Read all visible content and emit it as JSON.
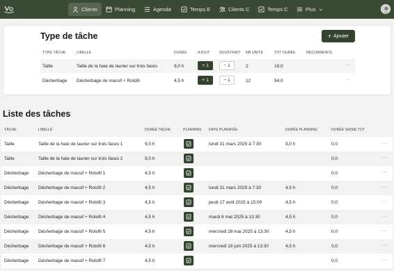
{
  "nav": {
    "items": [
      {
        "label": "Clients",
        "icon": "user-icon",
        "active": true
      },
      {
        "label": "Planning",
        "icon": "calendar-icon",
        "active": false
      },
      {
        "label": "Agenda",
        "icon": "list-icon",
        "active": false
      },
      {
        "label": "Temps E",
        "icon": "timesheet-icon",
        "active": false
      },
      {
        "label": "Clients C",
        "icon": "users-icon",
        "active": false
      },
      {
        "label": "Temps C",
        "icon": "timesheet-icon",
        "active": false
      },
      {
        "label": "Plus",
        "icon": "menu-icon",
        "active": false
      }
    ]
  },
  "task_types": {
    "title": "Type de tâche",
    "add_label": "Ajouter",
    "headers": {
      "type": "TYPE TÂCHE",
      "libelle": "LIBELLÉ",
      "duree": "DURÉE",
      "ajout": "AJOUT",
      "soustrait": "SOUSTRAIT",
      "nb_unite": "NB UNITÉ",
      "tot_duree": "TOT DURÉE",
      "recurrence": "RÉCURRENCE"
    },
    "rows": [
      {
        "type": "Taille",
        "libelle": "Taille de la haie de laurier sur trois faces",
        "duree": "9,0 h",
        "ajout": "1",
        "soustrait": "1",
        "nb_unite": "2",
        "tot_duree": "18,0",
        "menu": "···"
      },
      {
        "type": "Désherbage",
        "libelle": "Désherbage de massif + Rotofil",
        "duree": "4,5 h",
        "ajout": "1",
        "soustrait": "1",
        "nb_unite": "12",
        "tot_duree": "54,0",
        "menu": "···"
      }
    ]
  },
  "task_list": {
    "title": "Liste des tâches",
    "headers": {
      "tache": "TÂCHE",
      "libelle": "LIBELLÉ",
      "duree_tache": "DURÉE TÂCHE",
      "planning": "PLANNING",
      "date_planifiee": "DATE PLANIFIÉE",
      "duree_planning": "DURÉE PLANNING",
      "duree_saisie": "DURÉE SAISIE TOT"
    },
    "rows": [
      {
        "tache": "Taille",
        "libelle": "Taille de la haie de laurier sur trois faces 1",
        "duree_tache": "9,0 h",
        "date_planifiee": "lundi 31 mars 2025 à 7:30",
        "duree_planning": "9,0 h",
        "duree_saisie": "0,0",
        "menu": "···"
      },
      {
        "tache": "Taille",
        "libelle": "Taille de la haie de laurier sur trois faces 2",
        "duree_tache": "9,0 h",
        "date_planifiee": "",
        "duree_planning": "",
        "duree_saisie": "0,0",
        "menu": "···"
      },
      {
        "tache": "Désherbage",
        "libelle": "Désherbage de massif + Rotofil 1",
        "duree_tache": "4,5 h",
        "date_planifiee": "",
        "duree_planning": "",
        "duree_saisie": "0,0",
        "menu": "···"
      },
      {
        "tache": "Désherbage",
        "libelle": "Désherbage de massif + Rotofil 2",
        "duree_tache": "4,5 h",
        "date_planifiee": "lundi 31 mars 2025 à 7:30",
        "duree_planning": "4,5 h",
        "duree_saisie": "0,0",
        "menu": "···"
      },
      {
        "tache": "Désherbage",
        "libelle": "Désherbage de massif + Rotofil 3",
        "duree_tache": "4,5 h",
        "date_planifiee": "jeudi 17 avril 2025 à 15:00",
        "duree_planning": "4,5 h",
        "duree_saisie": "0,0",
        "menu": "···"
      },
      {
        "tache": "Désherbage",
        "libelle": "Désherbage de massif + Rotofil 4",
        "duree_tache": "4,5 h",
        "date_planifiee": "mardi 6 mai 2025 à 13:30",
        "duree_planning": "4,5 h",
        "duree_saisie": "0,0",
        "menu": "···"
      },
      {
        "tache": "Désherbage",
        "libelle": "Désherbage de massif + Rotofil 5",
        "duree_tache": "4,5 h",
        "date_planifiee": "mercredi 28 mai 2025 à 13:30",
        "duree_planning": "4,5 h",
        "duree_saisie": "0,0",
        "menu": "···"
      },
      {
        "tache": "Désherbage",
        "libelle": "Désherbage de massif + Rotofil 6",
        "duree_tache": "4,5 h",
        "date_planifiee": "mercredi 18 juin 2025 à 13:30",
        "duree_planning": "4,5 h",
        "duree_saisie": "0,0",
        "menu": "···"
      },
      {
        "tache": "Désherbage",
        "libelle": "Désherbage de massif + Rotofil 7",
        "duree_tache": "4,5 h",
        "date_planifiee": "",
        "duree_planning": "",
        "duree_saisie": "0,0",
        "menu": "···"
      }
    ]
  },
  "colors": {
    "nav_bg": "#3b4a35",
    "accent": "#34432f"
  }
}
